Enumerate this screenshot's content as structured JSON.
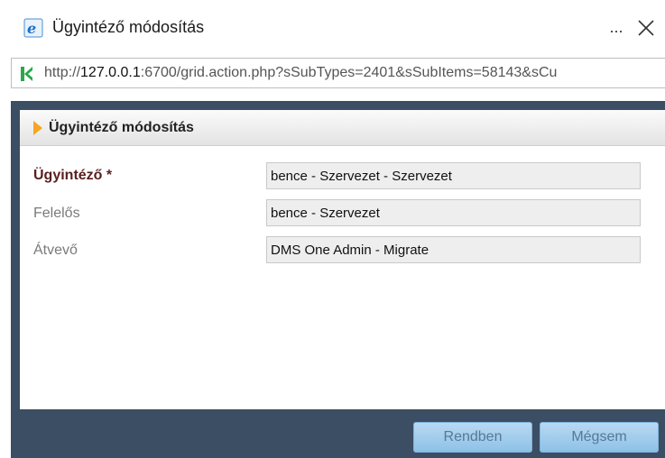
{
  "window": {
    "title": "Ügyintéző módosítás",
    "more_label": "...",
    "close_icon": "close-icon"
  },
  "address": {
    "url_prefix": "http://",
    "url_host": "127.0.0.1",
    "url_rest": ":6700/grid.action.php?sSubTypes=2401&sSubItems=58143&sCu"
  },
  "dialog": {
    "title": "Ügyintéző módosítás",
    "fields": [
      {
        "label": "Ügyintéző *",
        "value": "bence - Szervezet - Szervezet",
        "required": true
      },
      {
        "label": "Felelős",
        "value": "bence - Szervezet",
        "required": false
      },
      {
        "label": "Átvevő",
        "value": "DMS One Admin - Migrate",
        "required": false
      }
    ],
    "ok_label": "Rendben",
    "cancel_label": "Mégsem"
  },
  "colors": {
    "frame": "#3b4e63",
    "accent_arrow": "#f5a623",
    "button": "#a6cdee"
  }
}
